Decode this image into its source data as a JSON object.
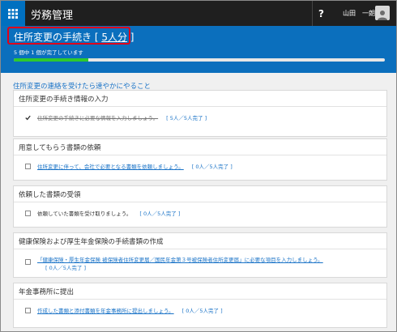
{
  "app": {
    "title": "労務管理",
    "help_label": "?",
    "user_name": "山田　一朗"
  },
  "procedure": {
    "title_prefix": "住所変更の手続き [",
    "title_count": "5人分",
    "title_suffix": "]",
    "progress_text": "5 個中 1 個が完了しています",
    "progress_fraction": 0.2
  },
  "section_link": "住所変更の連絡を受けたら速やかにやること",
  "tasks": [
    {
      "header": "住所変更の手続き情報の入力",
      "text": "住所変更の手続きに必要な情報を入力しましょう。",
      "status": "[ 5人／5人完了 ]",
      "checked": true,
      "done": true,
      "link": true
    },
    {
      "header": "用意してもらう書類の依頼",
      "text": "住所変更に伴って、会社で必要となる書類を依頼しましょう。",
      "status": "[ 0人／5人完了 ]",
      "checked": false,
      "done": false,
      "link": true
    },
    {
      "header": "依頼した書類の受領",
      "text": "依頼していた書類を受け取りましょう。",
      "status": "[ 0人／5人完了 ]",
      "checked": false,
      "done": false,
      "link": false
    },
    {
      "header": "健康保険および厚生年金保険の手続書類の作成",
      "text": "「健康保険・厚生年金保険 被保険者住所変更届／国民年金第３号被保険者住所変更届」に必要な項目を入力しましょう。",
      "status": "[ 0人／5人完了 ]",
      "checked": false,
      "done": false,
      "link": true
    },
    {
      "header": "年金事務所に提出",
      "text": "作成した書類と添付書類を年金事務所に提出しましょう。",
      "status": "[ 0人／5人完了 ]",
      "checked": false,
      "done": false,
      "link": true
    }
  ]
}
